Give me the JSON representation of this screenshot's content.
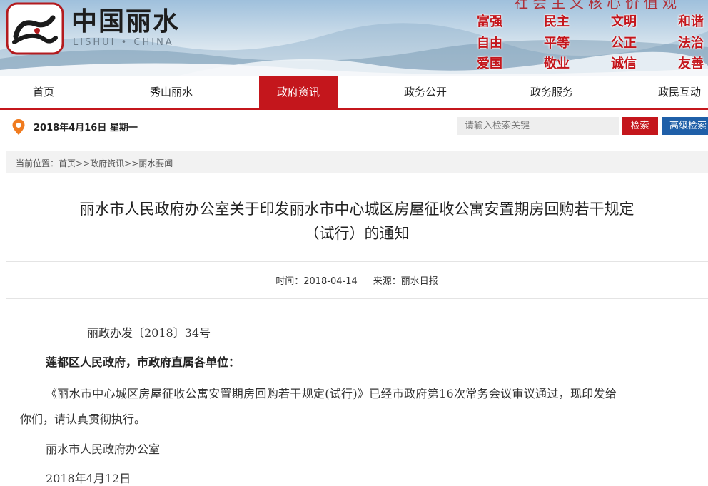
{
  "header": {
    "logo_cn": "中国丽水",
    "logo_en": "LISHUI • CHINA",
    "slogan_partial": "社会主义核心价值观",
    "core_values": [
      "富强",
      "民主",
      "文明",
      "和谐",
      "自由",
      "平等",
      "公正",
      "法治",
      "爱国",
      "敬业",
      "诚信",
      "友善"
    ]
  },
  "nav": {
    "items": [
      "首页",
      "秀山丽水",
      "政府资讯",
      "政务公开",
      "政务服务",
      "政民互动"
    ],
    "active_index": 2
  },
  "infobar": {
    "date": "2018年4月16日 星期一",
    "search_placeholder": "请输入检索关键",
    "search_button": "检索",
    "advanced_button": "高级检索"
  },
  "breadcrumb": {
    "prefix": "当前位置：",
    "items": [
      "首页",
      "政府资讯",
      "丽水要闻"
    ],
    "separator": ">>"
  },
  "article": {
    "title_line1": "丽水市人民政府办公室关于印发丽水市中心城区房屋征收公寓安置期房回购若干规定",
    "title_line2": "（试行）的通知",
    "meta_time": "时间：2018-04-14",
    "meta_source": "来源：丽水日报",
    "doc_number": "丽政办发〔2018〕34号",
    "salutation": "莲都区人民政府，市政府直属各单位：",
    "body_line1": "《丽水市中心城区房屋征收公寓安置期房回购若干规定(试行)》已经市政府第16次常务会议审议通过，现印发给",
    "body_line2": "你们，请认真贯彻执行。",
    "signature": "丽水市人民政府办公室",
    "sign_date": "2018年4月12日"
  },
  "colors": {
    "brand_red": "#c4161c",
    "advanced_blue": "#1f5fa8"
  }
}
